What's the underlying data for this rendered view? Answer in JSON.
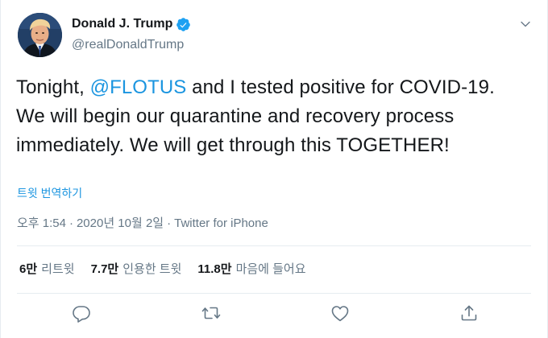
{
  "user": {
    "display_name": "Donald J. Trump",
    "handle": "@realDonaldTrump",
    "verified": true
  },
  "icons": {
    "verified": "verified-badge-icon",
    "more": "chevron-down-icon",
    "reply": "reply-icon",
    "retweet": "retweet-icon",
    "like": "heart-icon",
    "share": "share-icon"
  },
  "colors": {
    "link": "#1b95e0",
    "secondary_text": "#657786",
    "primary_text": "#14171a"
  },
  "tweet": {
    "text_before": "Tonight, ",
    "mention": "@FLOTUS",
    "text_after": " and I tested positive for COVID-19. We will begin our quarantine and recovery process immediately. We will get through this TOGETHER!",
    "translate_label": "트윗 번역하기",
    "time": "오후 1:54",
    "separator": "·",
    "date": "2020년 10월 2일",
    "source": "Twitter for iPhone"
  },
  "stats": {
    "retweets_value": "6만",
    "retweets_label": "리트윗",
    "quotes_value": "7.7만",
    "quotes_label": "인용한 트윗",
    "likes_value": "11.8만",
    "likes_label": "마음에 들어요"
  }
}
